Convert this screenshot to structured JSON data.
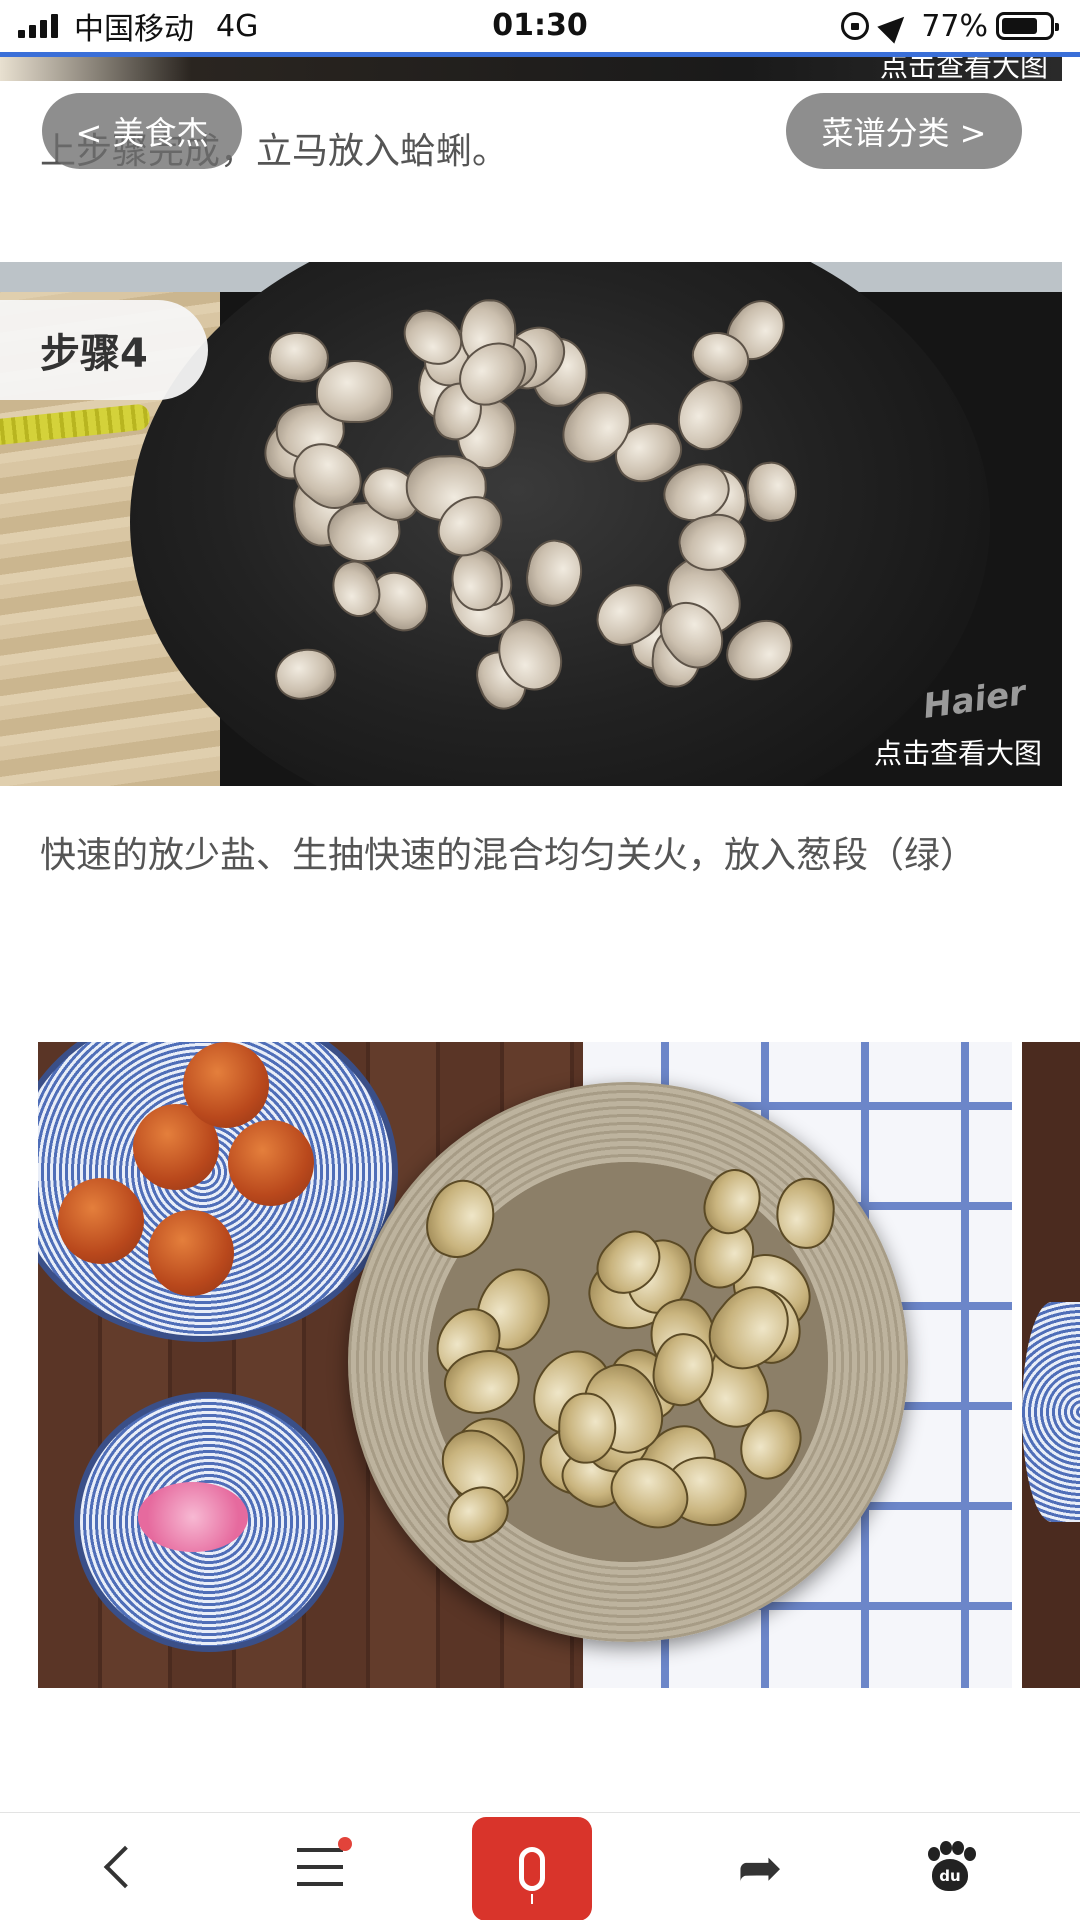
{
  "status_bar": {
    "carrier": "中国移动",
    "network": "4G",
    "time": "01:30",
    "battery_percent": "77%",
    "battery_level": 0.77
  },
  "top_image": {
    "view_large": "点击查看大图"
  },
  "nav": {
    "back_label": "< 美食杰",
    "category_label": "菜谱分类 >"
  },
  "steps": [
    {
      "text": "上步骤完成，立马放入蛤蜊。"
    },
    {
      "label": "步骤4",
      "view_large": "点击查看大图",
      "brand_mark": "Haier",
      "text": "快速的放少盐、生抽快速的混合均匀关火，放入葱段（绿）"
    }
  ],
  "toolbar": {
    "back_icon": "chevron-left-icon",
    "menu_icon": "menu-icon",
    "voice_icon": "microphone-icon",
    "share_icon": "share-icon",
    "home_icon": "baidu-paw-icon",
    "home_label": "du",
    "accent_color": "#d9342b",
    "badge_color": "#e2433a"
  }
}
